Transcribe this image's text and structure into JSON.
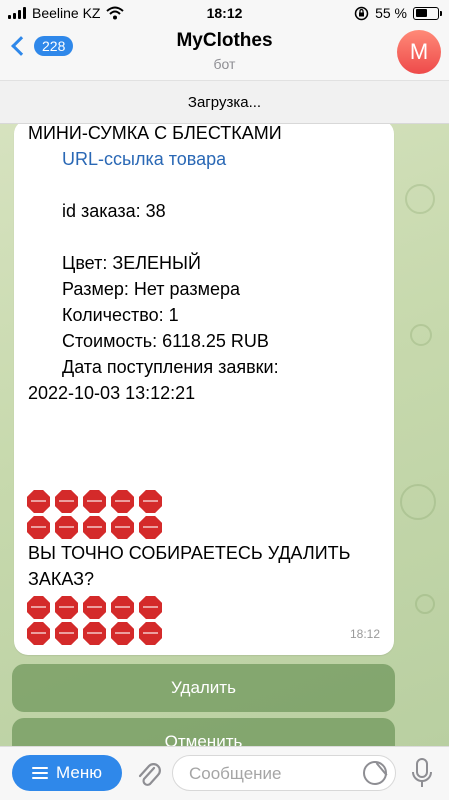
{
  "status_bar": {
    "carrier": "Beeline KZ",
    "time": "18:12",
    "battery": "55 %"
  },
  "header": {
    "back_count": "228",
    "title": "MyClothes",
    "subtitle": "бот",
    "avatar_letter": "M"
  },
  "loading_text": "Загрузка...",
  "message": {
    "product_name": "МИНИ-СУМКА С БЛЕСТКАМИ",
    "link_text": "URL-ссылка товара",
    "order_id": "id заказа: 38",
    "color": "Цвет: ЗЕЛЕНЫЙ",
    "size": "Размер: Нет размера",
    "quantity": "Количество: 1",
    "price": "Стоимость: 6118.25 RUB",
    "date_label": "Дата поступления заявки:",
    "date_value": "2022-10-03 13:12:21",
    "question_line1": "ВЫ ТОЧНО СОБИРАЕТЕСЬ УДАЛИТЬ",
    "question_line2": "ЗАКАЗ?",
    "time": "18:12"
  },
  "keyboard": {
    "delete_label": "Удалить",
    "cancel_label": "Отменить"
  },
  "input_bar": {
    "menu_label": "Меню",
    "placeholder": "Сообщение"
  },
  "colors": {
    "accent": "#2f88ea",
    "stop_red": "#d42a2a",
    "link": "#2a68b5"
  }
}
